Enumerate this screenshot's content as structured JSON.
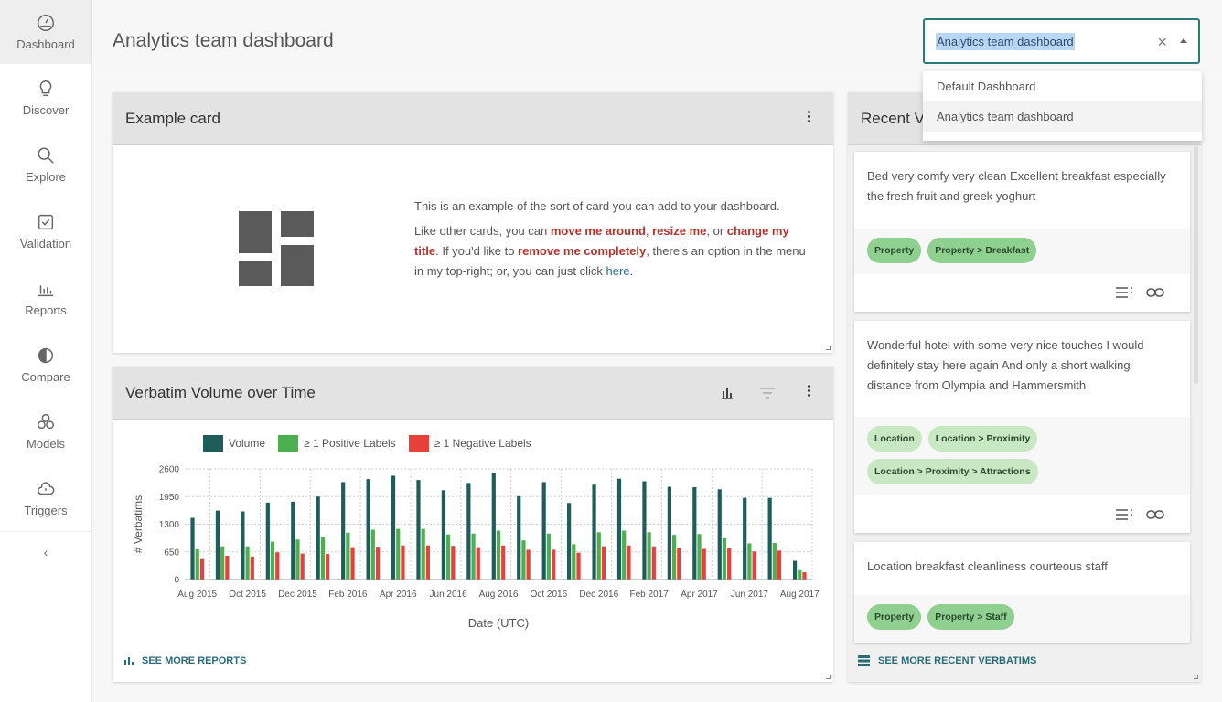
{
  "sidebar": {
    "items": [
      {
        "label": "Dashboard",
        "icon": "gauge-icon"
      },
      {
        "label": "Discover",
        "icon": "lightbulb-icon"
      },
      {
        "label": "Explore",
        "icon": "search-icon"
      },
      {
        "label": "Validation",
        "icon": "checkbox-icon"
      },
      {
        "label": "Reports",
        "icon": "bar-chart-icon"
      },
      {
        "label": "Compare",
        "icon": "contrast-icon"
      },
      {
        "label": "Models",
        "icon": "cubes-icon"
      },
      {
        "label": "Triggers",
        "icon": "cloud-alarm-icon"
      }
    ],
    "collapse_label": "‹"
  },
  "header": {
    "title": "Analytics team dashboard",
    "select_value": "Analytics team dashboard",
    "clear_label": "×",
    "options": [
      "Default Dashboard",
      "Analytics team dashboard"
    ]
  },
  "example_card": {
    "title": "Example card",
    "p1": "This is an example of the sort of card you can add to your dashboard.",
    "p2_a": "Like other cards, you can ",
    "p2_b": "move me around",
    "p2_c": ", ",
    "p2_d": "resize me",
    "p2_e": ", or ",
    "p2_f": "change my title",
    "p2_g": ". If you'd like to ",
    "p2_h": "remove me completely",
    "p2_i": ", there's an option in the menu in my top-right; or, you can just click ",
    "p2_j": "here",
    "p2_k": "."
  },
  "chart_card": {
    "title": "Verbatim Volume over Time",
    "see_more": "SEE MORE REPORTS"
  },
  "chart_data": {
    "type": "bar",
    "categories": [
      "Aug 2015",
      "Sep 2015",
      "Oct 2015",
      "Nov 2015",
      "Dec 2015",
      "Jan 2016",
      "Feb 2016",
      "Mar 2016",
      "Apr 2016",
      "May 2016",
      "Jun 2016",
      "Jul 2016",
      "Aug 2016",
      "Sep 2016",
      "Oct 2016",
      "Nov 2016",
      "Dec 2016",
      "Jan 2017",
      "Feb 2017",
      "Mar 2017",
      "Apr 2017",
      "May 2017",
      "Jun 2017",
      "Jul 2017",
      "Aug 2017"
    ],
    "tick_labels": [
      "Aug 2015",
      "Oct 2015",
      "Dec 2015",
      "Feb 2016",
      "Apr 2016",
      "Jun 2016",
      "Aug 2016",
      "Oct 2016",
      "Dec 2016",
      "Feb 2017",
      "Apr 2017",
      "Jun 2017",
      "Aug 2017"
    ],
    "series": [
      {
        "name": "Volume",
        "color": "#1f5c5c",
        "values": [
          1450,
          1620,
          1600,
          1810,
          1830,
          1950,
          2290,
          2360,
          2440,
          2340,
          2100,
          2270,
          2500,
          1960,
          2290,
          1800,
          2230,
          2370,
          2310,
          2180,
          2170,
          2120,
          1920,
          1920,
          440
        ]
      },
      {
        "name": "≥ 1 Positive Labels",
        "color": "#4caf50",
        "values": [
          710,
          780,
          780,
          890,
          940,
          1000,
          1100,
          1170,
          1190,
          1190,
          1060,
          1080,
          1150,
          920,
          1080,
          830,
          1110,
          1150,
          1110,
          1050,
          1070,
          970,
          850,
          860,
          220
        ]
      },
      {
        "name": "≥ 1 Negative Labels",
        "color": "#e8403a",
        "values": [
          480,
          560,
          540,
          640,
          610,
          600,
          760,
          770,
          800,
          800,
          790,
          760,
          800,
          700,
          700,
          630,
          780,
          800,
          780,
          730,
          720,
          730,
          660,
          680,
          170
        ]
      }
    ],
    "xlabel": "Date (UTC)",
    "ylabel": "# Verbatims",
    "ylim": [
      0,
      2600
    ],
    "yticks": [
      0,
      650,
      1300,
      1950,
      2600
    ],
    "legend": "top"
  },
  "verbatims": {
    "title": "Recent V",
    "see_more": "SEE MORE RECENT VERBATIMS",
    "items": [
      {
        "text": "Bed very comfy very clean Excellent breakfast especially the fresh fruit and greek yoghurt",
        "tags": [
          {
            "label": "Property",
            "strength": "strong"
          },
          {
            "label": "Property > Breakfast",
            "strength": "strong"
          }
        ]
      },
      {
        "text": "Wonderful hotel with some very nice touches I would definitely stay here again And only a short walking distance from Olympia and Hammersmith",
        "tags": [
          {
            "label": "Location",
            "strength": "light"
          },
          {
            "label": "Location > Proximity",
            "strength": "light"
          },
          {
            "label": "Location > Proximity > Attractions",
            "strength": "light"
          }
        ]
      },
      {
        "text": "Location breakfast cleanliness courteous staff",
        "tags": [
          {
            "label": "Property",
            "strength": "strong"
          },
          {
            "label": "Property > Staff",
            "strength": "strong"
          }
        ]
      }
    ]
  },
  "colors": {
    "accent": "#2b7a78",
    "highlight": "#b0332c",
    "tag_strong": "#8fcf8f",
    "tag_light": "#c8e8c4"
  }
}
